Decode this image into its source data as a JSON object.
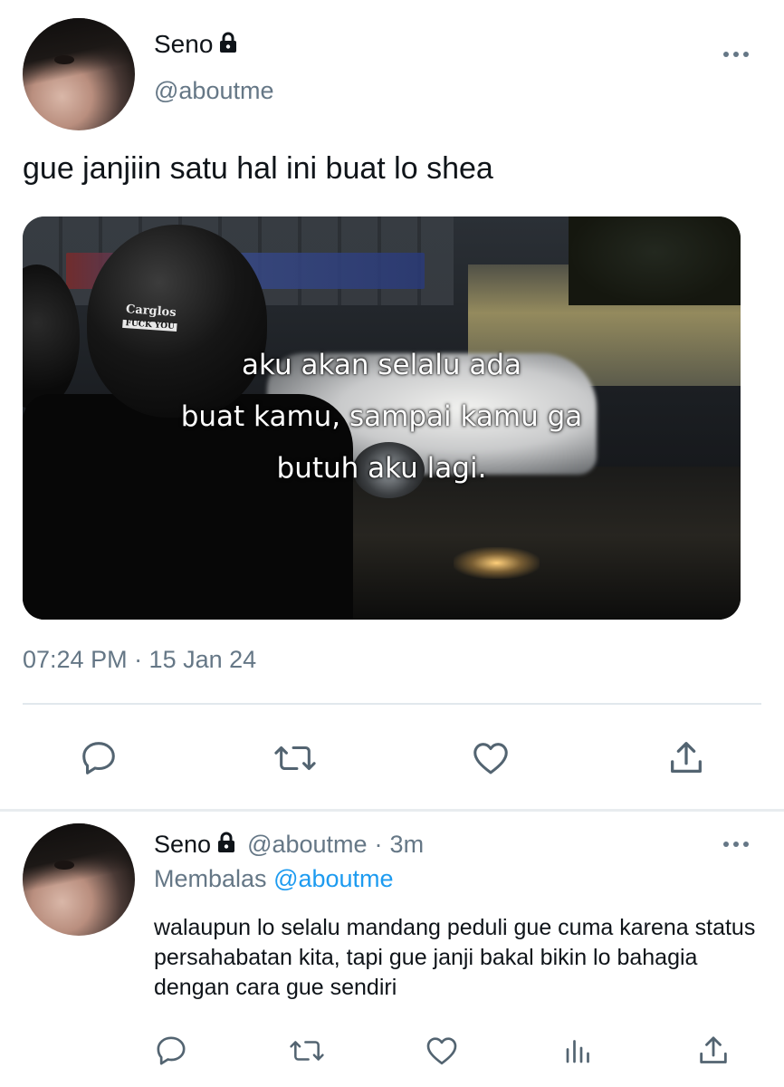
{
  "tweet": {
    "author_name": "Seno",
    "handle": "@aboutme",
    "text": "gue janjiin satu hal ini buat lo shea",
    "media": {
      "overlay_lines": [
        "aku akan selalu ada",
        "buat kamu, sampai kamu ga",
        "butuh aku lagi."
      ],
      "helmet_sticker_top": "Carglos",
      "helmet_sticker_bottom": "FUCK YOU"
    },
    "timestamp": "07:24 PM · 15 Jan 24",
    "more_icon": "more-horizontal-icon",
    "lock_icon": "lock-icon",
    "actions": [
      "reply-icon",
      "retweet-icon",
      "like-icon",
      "share-icon"
    ]
  },
  "reply": {
    "author_name": "Seno",
    "handle": "@aboutme",
    "time": "3m",
    "separator": "·",
    "replying_to_prefix": "Membalas",
    "replying_to_handle": "@aboutme",
    "text": "walaupun lo selalu mandang peduli gue cuma karena status persahabatan kita, tapi gue janji bakal bikin lo bahagia dengan cara gue sendiri",
    "actions": [
      "reply-icon",
      "retweet-icon",
      "like-icon",
      "analytics-icon",
      "share-icon"
    ]
  },
  "colors": {
    "secondary_text": "#657786",
    "link": "#1d9bf0",
    "divider": "#e1e8ed"
  }
}
